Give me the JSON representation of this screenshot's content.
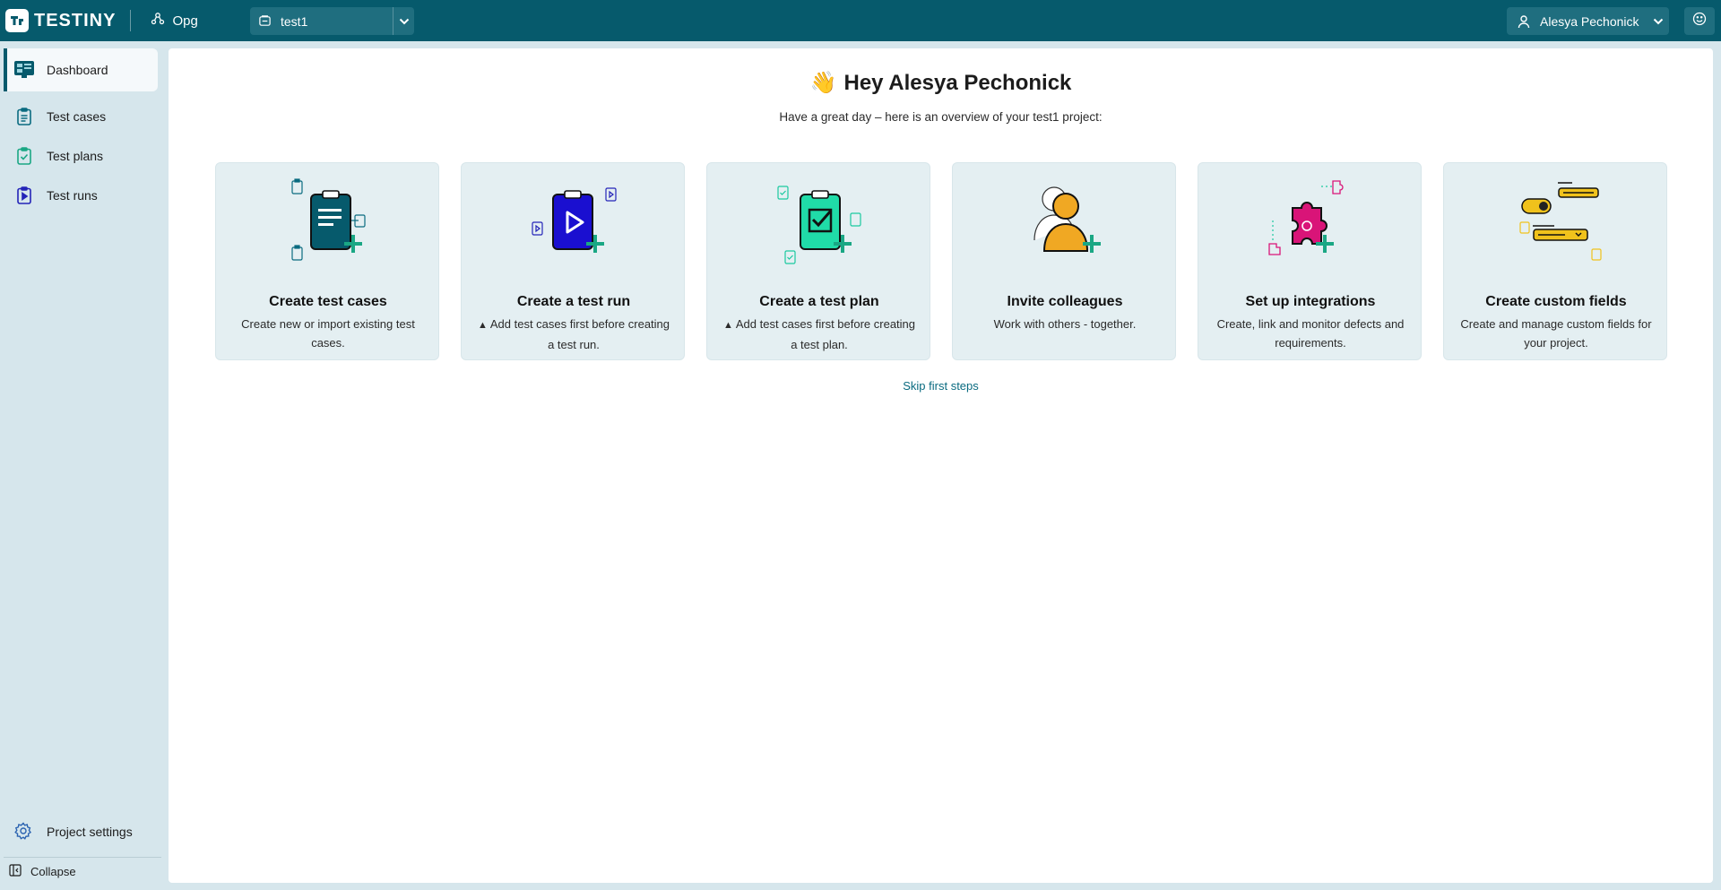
{
  "app": {
    "brand": "TESTINY",
    "org": "Opg"
  },
  "project_select": {
    "value": "test1"
  },
  "user": {
    "name": "Alesya Pechonick"
  },
  "sidebar": {
    "items": [
      {
        "label": "Dashboard",
        "icon": "dashboard-icon",
        "active": true
      },
      {
        "label": "Test cases",
        "icon": "test-cases-icon"
      },
      {
        "label": "Test plans",
        "icon": "test-plans-icon"
      },
      {
        "label": "Test runs",
        "icon": "test-runs-icon"
      }
    ],
    "settings_label": "Project settings",
    "collapse_label": "Collapse"
  },
  "main": {
    "greeting_emoji": "👋",
    "greeting": "Hey Alesya Pechonick",
    "subtitle": "Have a great day – here is an overview of your test1 project:",
    "cards": [
      {
        "title": "Create test cases",
        "desc": "Create new or import existing test cases.",
        "warning": false,
        "icon": "clipboard-teal-icon"
      },
      {
        "title": "Create a test run",
        "desc": "Add test cases first before creating a test run.",
        "warning": true,
        "icon": "clipboard-play-icon"
      },
      {
        "title": "Create a test plan",
        "desc": "Add test cases first before creating a test plan.",
        "warning": true,
        "icon": "clipboard-check-icon"
      },
      {
        "title": "Invite colleagues",
        "desc": "Work with others - together.",
        "warning": false,
        "icon": "people-icon"
      },
      {
        "title": "Set up integrations",
        "desc": "Create, link and monitor defects and requirements.",
        "warning": false,
        "icon": "puzzle-icon"
      },
      {
        "title": "Create custom fields",
        "desc": "Create and manage custom fields for your project.",
        "warning": false,
        "icon": "custom-fields-icon"
      }
    ],
    "skip_label": "Skip first steps"
  },
  "colors": {
    "topbar": "#065a6c",
    "sidebar": "#d6e6ec",
    "card": "#e4eff2",
    "accent": "#1aa784"
  }
}
